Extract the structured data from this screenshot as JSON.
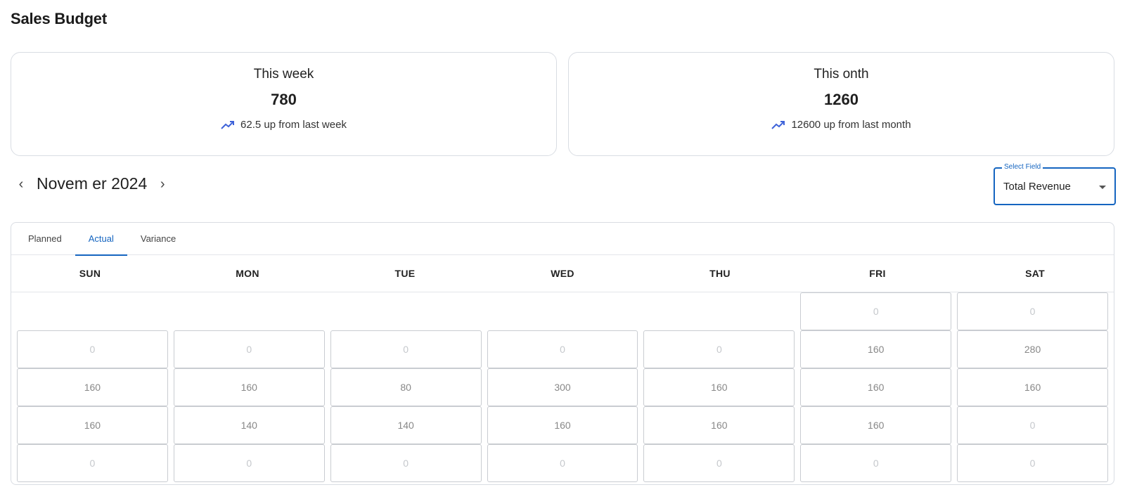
{
  "page": {
    "title": "Sales Budget"
  },
  "stats": {
    "week": {
      "label": "This week",
      "value": "780",
      "trend": "62.5 up from last week"
    },
    "month": {
      "label": "This  onth",
      "value": "1260",
      "trend": "12600 up from last month"
    }
  },
  "calendar_header": {
    "month_label": "Novem  er 2024",
    "prev_icon": "chevron-left-icon",
    "next_icon": "chevron-right-icon"
  },
  "select_field": {
    "legend": "Select Field",
    "value": "Total Revenue"
  },
  "tabs": [
    {
      "label": "Planned",
      "active": false
    },
    {
      "label": "Actual",
      "active": true
    },
    {
      "label": "Variance",
      "active": false
    }
  ],
  "weekdays": [
    "SUN",
    "MON",
    "TUE",
    "WED",
    "THU",
    "FRI",
    "SAT"
  ],
  "weeks": [
    [
      null,
      null,
      null,
      null,
      null,
      "0",
      "0"
    ],
    [
      "0",
      "0",
      "0",
      "0",
      "0",
      "160",
      "280"
    ],
    [
      "160",
      "160",
      "80",
      "300",
      "160",
      "160",
      "160"
    ],
    [
      "160",
      "140",
      "140",
      "160",
      "160",
      "160",
      "0"
    ],
    [
      "0",
      "0",
      "0",
      "0",
      "0",
      "0",
      "0"
    ]
  ],
  "colors": {
    "accent": "#1565c0",
    "trend": "#3f63d9",
    "border": "#d9dde3"
  }
}
